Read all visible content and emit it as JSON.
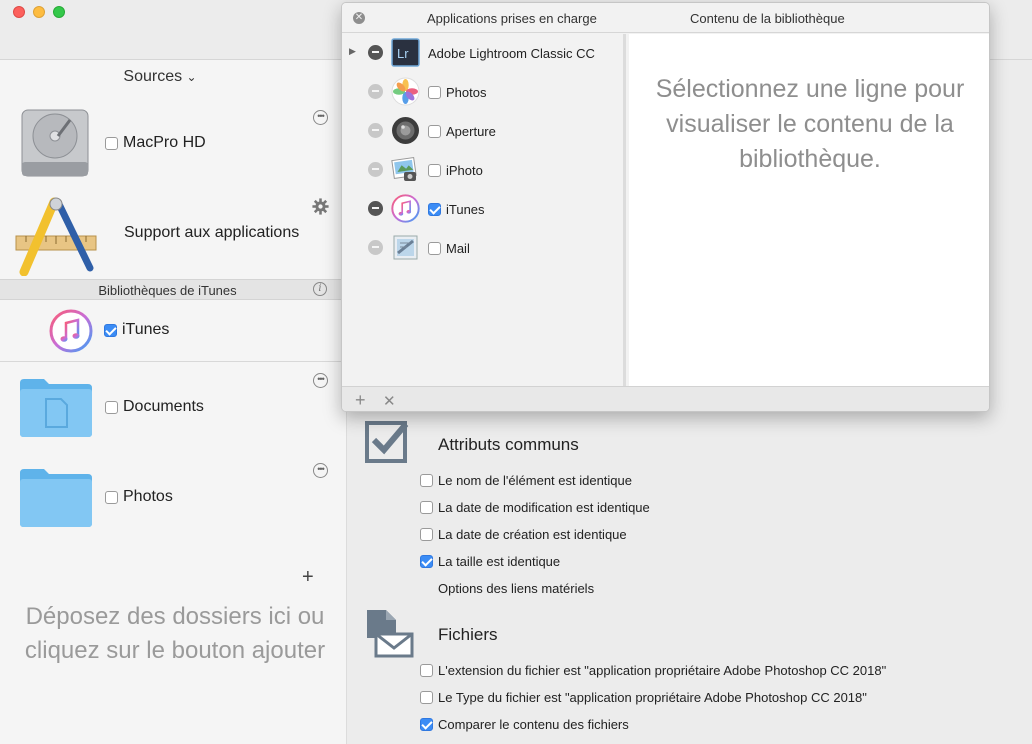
{
  "sidebar": {
    "sources_label": "Sources",
    "sources_chevron": "⌄",
    "items": [
      {
        "label": "MacPro HD",
        "checked": false,
        "icon": "hard-drive-icon"
      },
      {
        "label": "Support aux applications",
        "icon": "applications-icon"
      }
    ],
    "itunes_section": "Bibliothèques de iTunes",
    "itunes_item": {
      "label": "iTunes",
      "checked": true
    },
    "folders": [
      {
        "label": "Documents",
        "checked": false
      },
      {
        "label": "Photos",
        "checked": false
      }
    ],
    "add_symbol": "+",
    "drop_hint": "Déposez des dossiers ici ou cliquez sur le bouton ajouter"
  },
  "popover": {
    "close_symbol": "✕",
    "col1_title": "Applications prises en charge",
    "col2_title": "Contenu de la bibliothèque",
    "rows": [
      {
        "label": "Adobe Lightroom Classic CC",
        "has_checkbox": false,
        "icon": "lightroom-icon",
        "icon_text": "Lr",
        "active": true
      },
      {
        "label": "Photos",
        "has_checkbox": true,
        "checked": false,
        "icon": "photos-icon",
        "active": false
      },
      {
        "label": "Aperture",
        "has_checkbox": true,
        "checked": false,
        "icon": "aperture-icon",
        "active": false
      },
      {
        "label": "iPhoto",
        "has_checkbox": true,
        "checked": false,
        "icon": "iphoto-icon",
        "active": false
      },
      {
        "label": "iTunes",
        "has_checkbox": true,
        "checked": true,
        "icon": "itunes-icon",
        "active": true
      },
      {
        "label": "Mail",
        "has_checkbox": true,
        "checked": false,
        "icon": "mail-icon",
        "active": false
      }
    ],
    "empty_message": "Sélectionnez une ligne pour visualiser le contenu de la bibliothèque.",
    "footer_add": "+",
    "footer_remove": "✕"
  },
  "main": {
    "common": {
      "title": "Attributs communs",
      "options": [
        {
          "label": "Le nom de l'élément est identique",
          "checked": false
        },
        {
          "label": "La date de modification est identique",
          "checked": false
        },
        {
          "label": "La date de création est identique",
          "checked": false
        },
        {
          "label": "La taille est identique",
          "checked": true
        }
      ],
      "hardlinks_label": "Options des liens matériels"
    },
    "files": {
      "title": "Fichiers",
      "options": [
        {
          "label": "L'extension du fichier est \"application propriétaire Adobe Photoshop CC 2018\"",
          "checked": false
        },
        {
          "label": "Le Type du fichier est \"application propriétaire Adobe Photoshop CC 2018\"",
          "checked": false
        },
        {
          "label": "Comparer le contenu des fichiers",
          "checked": true
        }
      ]
    }
  },
  "colors": {
    "accent": "#3b8cf5",
    "sidebar_bg": "#f5f5f5",
    "main_bg": "#ececec"
  }
}
